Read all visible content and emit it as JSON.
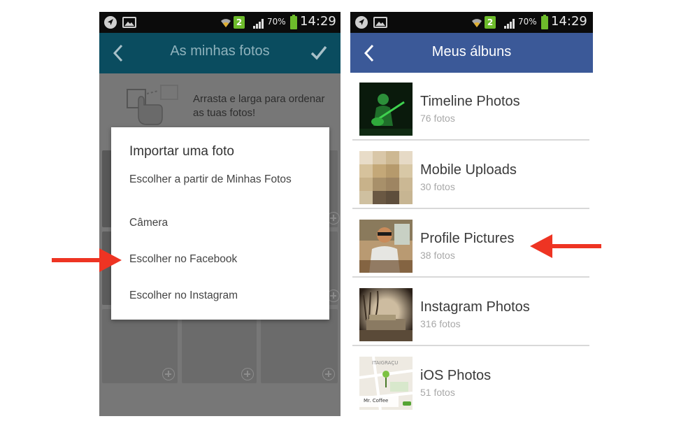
{
  "colors": {
    "left_header_bg": "#0a4c5f",
    "right_header_bg": "#3b5998",
    "annotation_arrow": "#ee3423",
    "battery_green": "#6dbb2b"
  },
  "status_bar": {
    "icons": [
      "navigation-icon",
      "image-icon",
      "wifi-icon",
      "notification-badge",
      "signal-icon",
      "battery-icon"
    ],
    "notification_count": "2",
    "battery_percent": "70%",
    "time": "14:29"
  },
  "left_screen": {
    "header": {
      "title": "As minhas fotos",
      "back_icon": "chevron-left-icon",
      "confirm_icon": "checkmark-icon"
    },
    "hint_text": "Arrasta e larga para ordenar as tuas fotos!",
    "dialog": {
      "title": "Importar uma foto",
      "options": [
        "Escolher a partir de Minhas Fotos",
        "Câmera",
        "Escolher no Facebook",
        "Escolher no Instagram"
      ]
    }
  },
  "right_screen": {
    "header": {
      "title": "Meus álbuns",
      "back_icon": "chevron-left-icon"
    },
    "albums": [
      {
        "name": "Timeline Photos",
        "count": "76 fotos"
      },
      {
        "name": "Mobile Uploads",
        "count": "30 fotos"
      },
      {
        "name": "Profile Pictures",
        "count": "38 fotos"
      },
      {
        "name": "Instagram Photos",
        "count": "316 fotos"
      },
      {
        "name": "iOS Photos",
        "count": "51 fotos"
      }
    ],
    "ios_map_labels": {
      "top": "ITAIGRAÇU",
      "place": "Mr. Coffee"
    }
  }
}
